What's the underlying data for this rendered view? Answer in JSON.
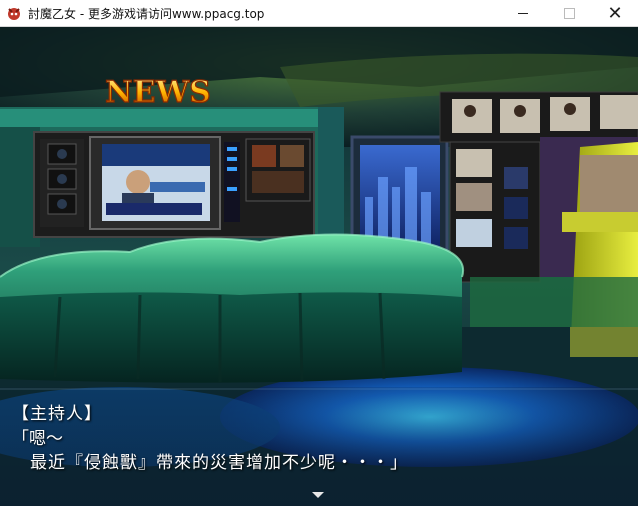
{
  "window": {
    "title": "討魔乙女 - 更多游戏请访问www.ppacg.top",
    "minimize_icon": "minimize-icon",
    "maximize_icon": "maximize-icon",
    "close_icon": "close-icon",
    "close_glyph": "✕"
  },
  "scene": {
    "news_sign": "NEWS"
  },
  "dialogue": {
    "speaker": "【主持人】",
    "line1": "「嗯～",
    "line2": "最近『侵蝕獸』帶來的災害增加不少呢・・・」",
    "continue_icon": "continue-arrow-icon"
  }
}
